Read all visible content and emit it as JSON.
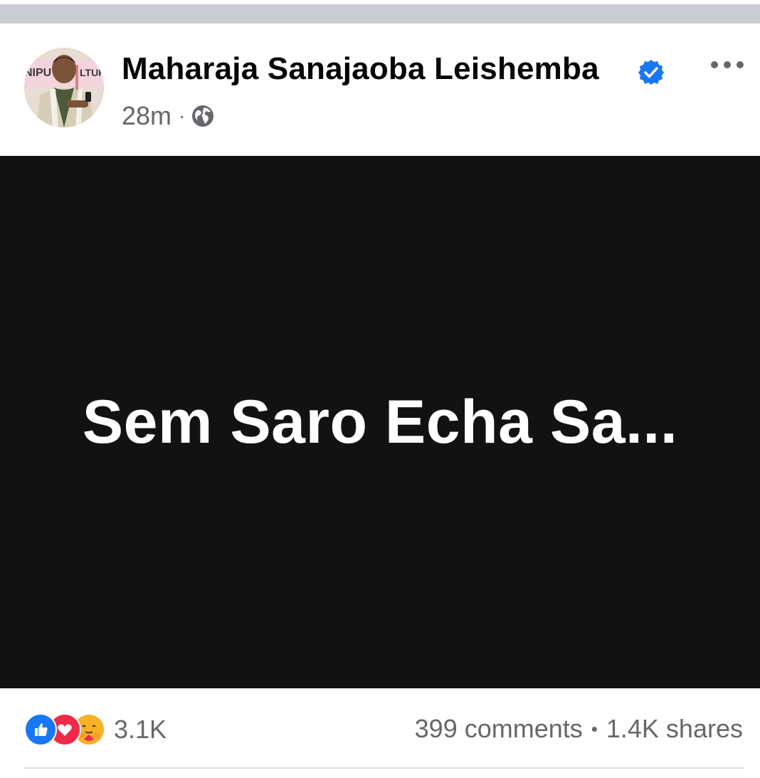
{
  "post": {
    "author_name": "Maharaja Sanajaoba Leishemba",
    "timestamp": "28m",
    "separator": "·",
    "privacy_icon": "globe-icon",
    "verified_icon": "verified-badge-icon",
    "more_icon": "more-options-icon",
    "avatar_backdrop_text": "NIPU",
    "avatar_backdrop_text_2": "LTUR",
    "body_text": "Sem Saro Echa Sa...",
    "media_background": "#121212"
  },
  "engagement": {
    "reaction_icons": [
      "like-icon",
      "love-icon",
      "care-icon"
    ],
    "reaction_count": "3.1K",
    "comments": "399 comments",
    "separator": "•",
    "shares": "1.4K shares"
  },
  "colors": {
    "verified_blue": "#1877f2",
    "secondary_text": "#65676b",
    "primary_text": "#050505"
  }
}
